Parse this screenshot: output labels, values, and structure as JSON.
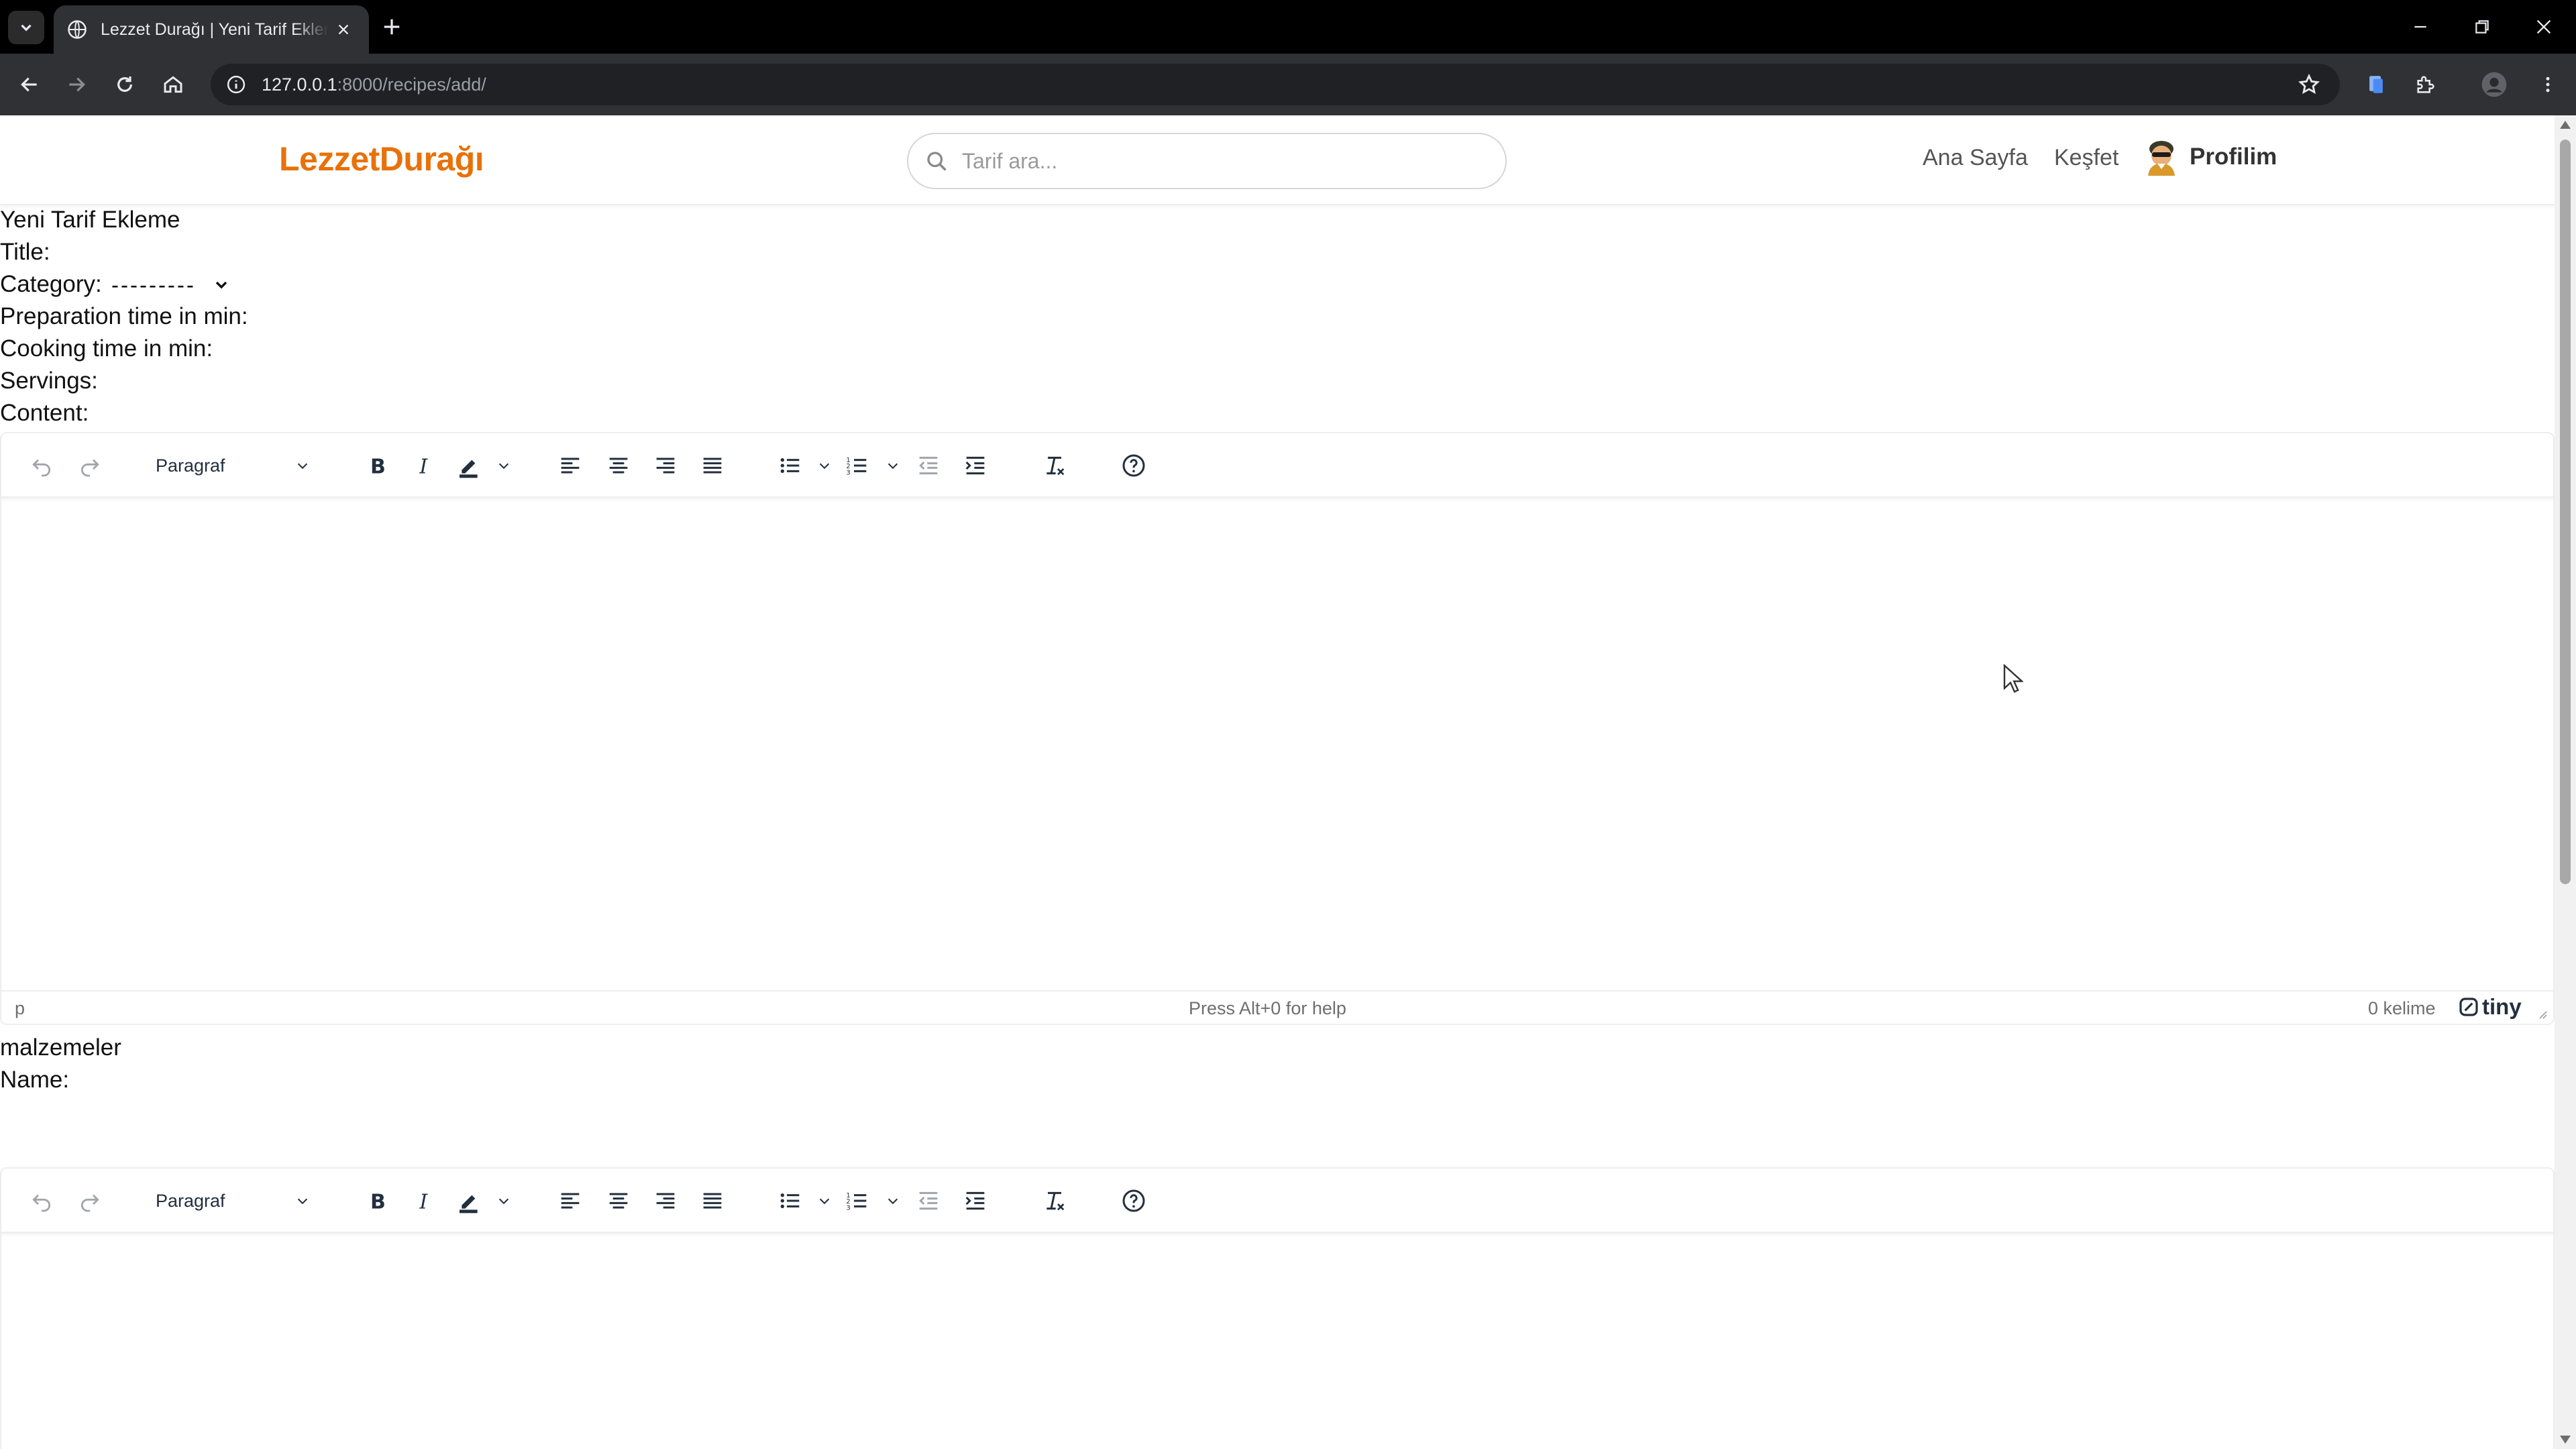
{
  "browser": {
    "tab_title": "Lezzet Durağı | Yeni Tarif Ekleme",
    "url_host": "127.0.0.1",
    "url_rest": ":8000/recipes/add/"
  },
  "header": {
    "logo": "LezzetDurağı",
    "search_placeholder": "Tarif ara...",
    "nav": {
      "home": "Ana Sayfa",
      "explore": "Keşfet",
      "profile": "Profilim"
    }
  },
  "form": {
    "heading": "Yeni Tarif Ekleme",
    "title_label": "Title:",
    "category_label": "Category:",
    "category_selected": "---------",
    "prep_label": "Preparation time in min:",
    "cook_label": "Cooking time in min:",
    "servings_label": "Servings:",
    "content_label": "Content:",
    "ingredients_heading": "malzemeler",
    "name_label": "Name:"
  },
  "editor": {
    "block_format": "Paragraf",
    "status_path": "p",
    "help_text": "Press Alt+0 for help",
    "word_count": "0 kelime",
    "brand": "tiny"
  },
  "colors": {
    "brand_orange": "#e8710a",
    "chrome_dark": "#303134",
    "tabstrip": "#000000"
  }
}
